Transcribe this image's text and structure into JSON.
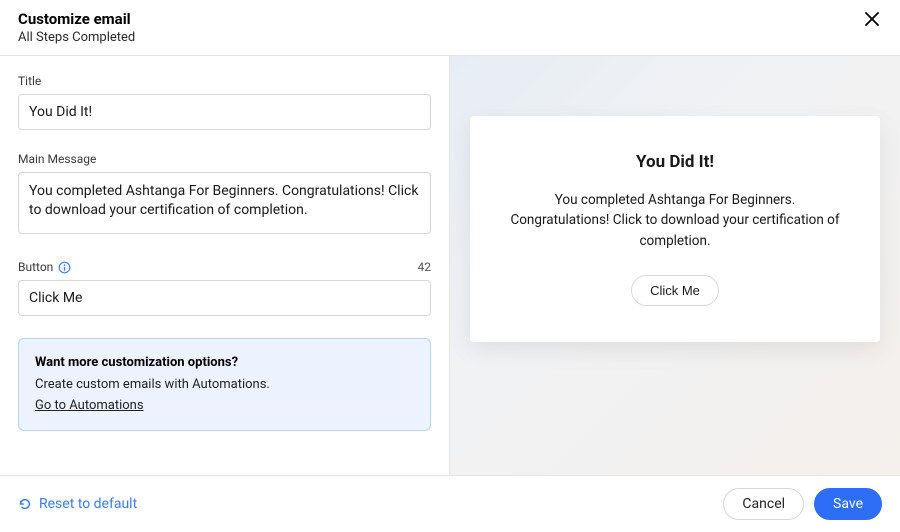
{
  "header": {
    "title": "Customize email",
    "subtitle": "All Steps Completed"
  },
  "form": {
    "title_label": "Title",
    "title_value": "You Did It!",
    "message_label": "Main Message",
    "message_value": "You completed Ashtanga For Beginners. Congratulations! Click to download your certification of completion.",
    "button_label": "Button",
    "button_value": "Click Me",
    "button_char_count": "42"
  },
  "callout": {
    "title": "Want more customization options?",
    "body": "Create custom emails with Automations.",
    "link": "Go to Automations"
  },
  "preview": {
    "title": "You Did It!",
    "message": "You completed Ashtanga For Beginners. Congratulations! Click to download your certification of completion.",
    "button": "Click Me"
  },
  "footer": {
    "reset": "Reset to default",
    "cancel": "Cancel",
    "save": "Save"
  }
}
